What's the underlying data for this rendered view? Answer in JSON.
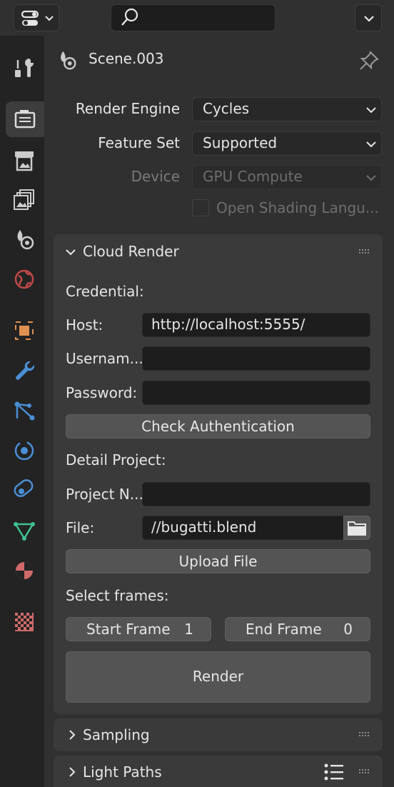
{
  "header": {
    "editor_type_icon": "properties-editor-icon",
    "search_placeholder": "",
    "options_icon": "chevron-down-icon"
  },
  "tabs": [
    {
      "name": "tool",
      "icon": "tool-icon",
      "active": false
    },
    {
      "name": "render",
      "icon": "render-icon",
      "active": true
    },
    {
      "name": "output",
      "icon": "output-icon",
      "active": false
    },
    {
      "name": "view-layer",
      "icon": "view-layer-icon",
      "active": false
    },
    {
      "name": "scene",
      "icon": "scene-icon",
      "active": false
    },
    {
      "name": "world",
      "icon": "world-icon",
      "active": false
    },
    {
      "name": "object",
      "icon": "object-icon",
      "active": false
    },
    {
      "name": "modifiers",
      "icon": "wrench-icon",
      "active": false
    },
    {
      "name": "particles",
      "icon": "particles-icon",
      "active": false
    },
    {
      "name": "physics",
      "icon": "physics-icon",
      "active": false
    },
    {
      "name": "constraints",
      "icon": "constraints-icon",
      "active": false
    },
    {
      "name": "data",
      "icon": "mesh-data-icon",
      "active": false
    },
    {
      "name": "material",
      "icon": "material-icon",
      "active": false
    },
    {
      "name": "texture",
      "icon": "texture-icon",
      "active": false
    }
  ],
  "context": {
    "title": "Scene.003"
  },
  "render": {
    "engine_label": "Render Engine",
    "engine_value": "Cycles",
    "feature_set_label": "Feature Set",
    "feature_set_value": "Supported",
    "device_label": "Device",
    "device_value": "GPU Compute",
    "osl_label": "Open Shading Langu..."
  },
  "cloud_render": {
    "title": "Cloud Render",
    "credential_label": "Credential:",
    "host_label": "Host:",
    "host_value": "http://localhost:5555/",
    "username_label": "Usernam...",
    "username_value": "",
    "password_label": "Password:",
    "password_value": "",
    "check_auth_label": "Check Authentication",
    "detail_project_label": "Detail Project:",
    "project_name_label": "Project N...",
    "project_name_value": "",
    "file_label": "File:",
    "file_value": "//bugatti.blend",
    "upload_label": "Upload File",
    "select_frames_label": "Select frames:",
    "start_frame_label": "Start Frame",
    "start_frame_value": "1",
    "end_frame_label": "End Frame",
    "end_frame_value": "0",
    "render_label": "Render"
  },
  "collapsed_panels": {
    "sampling": "Sampling",
    "light_paths": "Light Paths"
  },
  "colors": {
    "bg": "#303030",
    "panel": "#3a3a3a",
    "field": "#1d1d1d",
    "button": "#545454",
    "accent_orange": "#e09050",
    "accent_blue": "#4a8fd6"
  }
}
